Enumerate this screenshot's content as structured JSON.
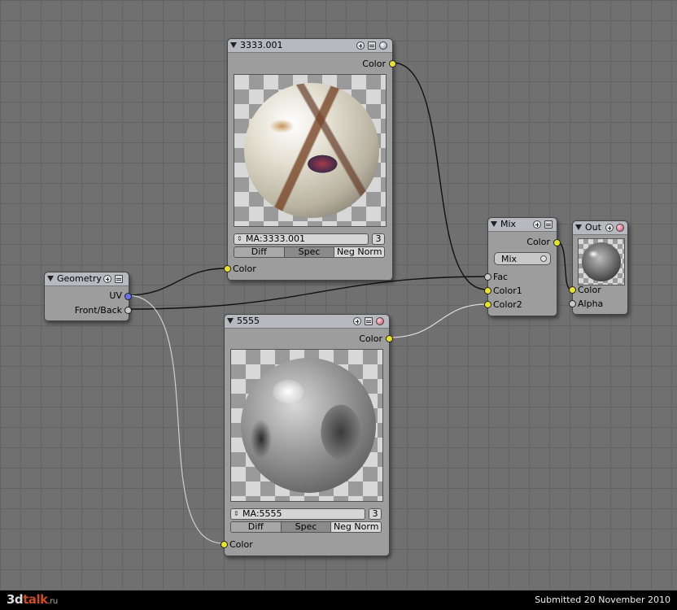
{
  "nodes": {
    "material1": {
      "title": "3333.001",
      "output_color_label": "Color",
      "input_color_label": "Color",
      "material_field": "MA:3333.001",
      "users": "3",
      "toggles": [
        "Diff",
        "Spec",
        "Neg Norm"
      ]
    },
    "material2": {
      "title": "5555",
      "output_color_label": "Color",
      "input_color_label": "Color",
      "material_field": "MA:5555",
      "users": "3",
      "toggles": [
        "Diff",
        "Spec",
        "Neg Norm"
      ]
    },
    "geometry": {
      "title": "Geometry",
      "outputs": [
        "UV",
        "Front/Back"
      ]
    },
    "mix": {
      "title": "Mix",
      "output_color_label": "Color",
      "blend_mode": "Mix",
      "inputs": [
        "Fac",
        "Color1",
        "Color2"
      ]
    },
    "output": {
      "title": "Out",
      "inputs": [
        "Color",
        "Alpha"
      ]
    }
  },
  "footer": {
    "logo_left": "3d",
    "logo_mid": "talk",
    "logo_tld": ".ru",
    "submitted": "Submitted 20 November 2010"
  },
  "colors": {
    "socket_color": "#e8e32c",
    "socket_vector": "#6a6ef0",
    "socket_value": "#c8c8c8",
    "node_body": "#9d9d9d",
    "node_header": "#b8b8c0"
  },
  "icons": [
    "collapse-icon",
    "plus-icon",
    "menu-icon",
    "preview-sphere-icon"
  ]
}
